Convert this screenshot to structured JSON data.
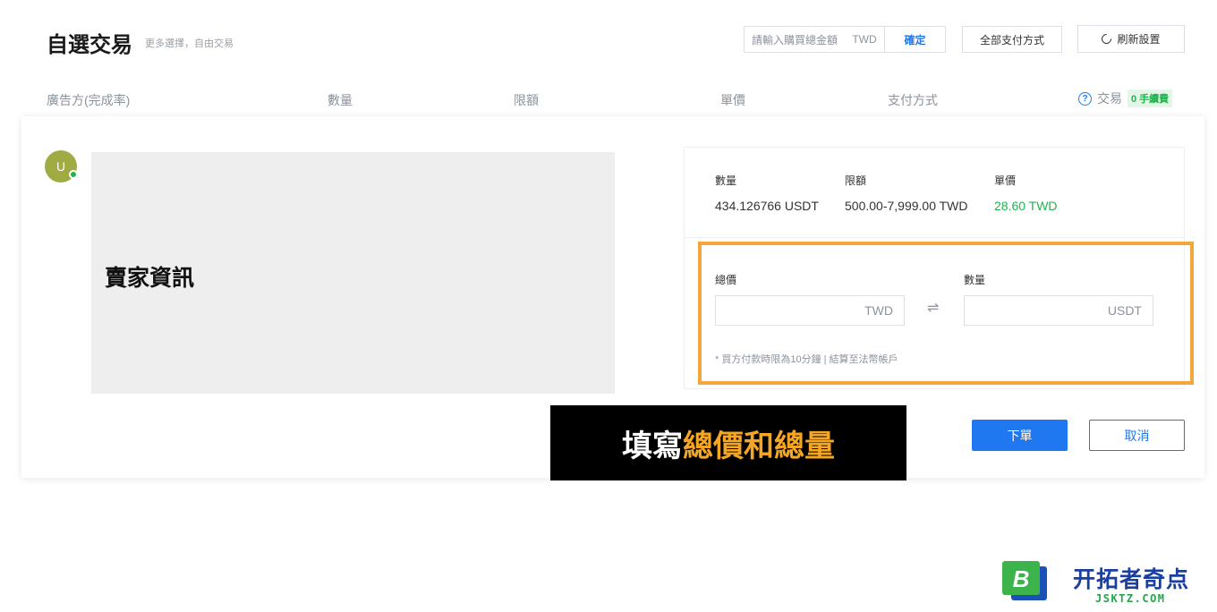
{
  "header": {
    "title": "自選交易",
    "subtitle": "更多選擇，自由交易",
    "amount_input": {
      "placeholder": "請輸入購買總金額",
      "currency": "TWD",
      "confirm_label": "確定"
    },
    "payment_filter_label": "全部支付方式",
    "refresh_label": "刷新設置"
  },
  "table_header": {
    "advertiser": "廣告方(完成率)",
    "quantity": "數量",
    "limit": "限額",
    "price": "單價",
    "payment": "支付方式",
    "trade": "交易",
    "fee_badge": "0 手續費",
    "help_glyph": "?"
  },
  "seller": {
    "avatar_letter": "U",
    "info_label": "賣家資訊"
  },
  "offer": {
    "quantity_label": "數量",
    "quantity_value": "434.126766 USDT",
    "limit_label": "限額",
    "limit_value": "500.00-7,999.00 TWD",
    "price_label": "單價",
    "price_value": "28.60 TWD"
  },
  "order_form": {
    "total_label": "總價",
    "total_currency": "TWD",
    "amount_label": "數量",
    "amount_currency": "USDT",
    "swap_glyph": "⇌",
    "note": "* 買方付款時限為10分鐘 | 結算至法幣帳戶"
  },
  "actions": {
    "order_label": "下單",
    "cancel_label": "取消"
  },
  "caption": {
    "part1": "填寫",
    "part2": "總價和總量"
  },
  "watermark": {
    "icon_letter": "B",
    "name": "开拓者奇点",
    "domain": "JSKTZ.COM"
  },
  "colors": {
    "accent_blue": "#1f78f0",
    "price_green": "#21b34d",
    "highlight_orange": "#f3a73b"
  }
}
